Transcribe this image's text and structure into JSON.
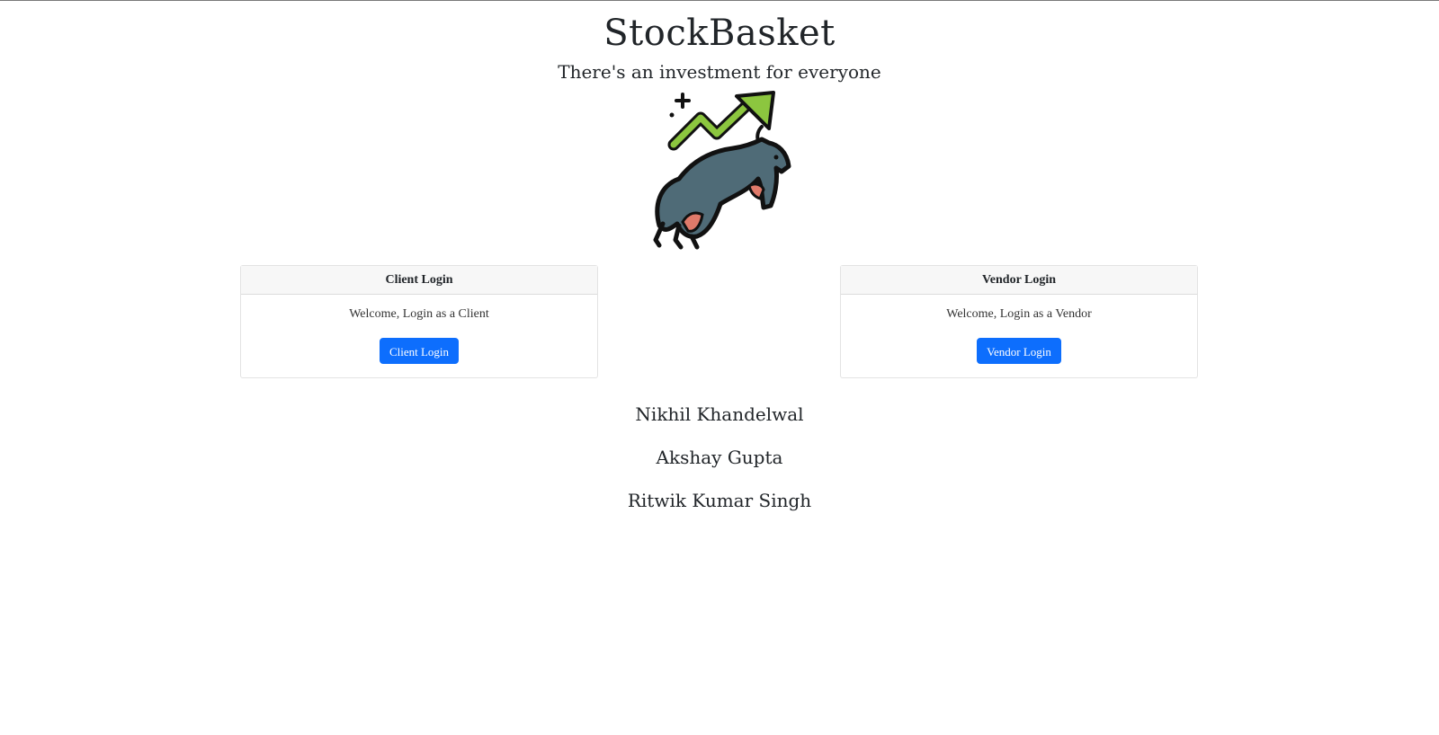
{
  "header": {
    "title": "StockBasket",
    "tagline": "There's an investment for everyone",
    "logo_icon": "bull-market-icon"
  },
  "cards": {
    "client": {
      "header": "Client Login",
      "text": "Welcome, Login as a Client",
      "button_label": "Client Login"
    },
    "vendor": {
      "header": "Vendor Login",
      "text": "Welcome, Login as a Vendor",
      "button_label": "Vendor Login"
    }
  },
  "team": [
    "Nikhil Khandelwal",
    "Akshay Gupta",
    "Ritwik Kumar Singh"
  ],
  "colors": {
    "accent": "#0d6efd",
    "arrow": "#8cc63f",
    "bull": "#4f6b77",
    "bull_belly": "#e07a6a"
  }
}
